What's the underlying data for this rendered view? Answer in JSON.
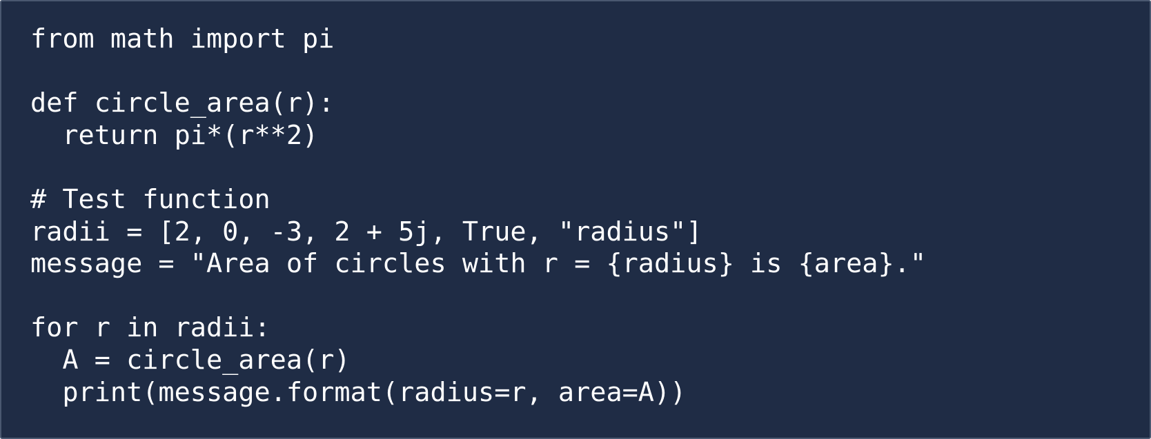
{
  "code": {
    "language": "python",
    "lines": [
      "from math import pi",
      "",
      "def circle_area(r):",
      "  return pi*(r**2)",
      "",
      "# Test function",
      "radii = [2, 0, -3, 2 + 5j, True, \"radius\"]",
      "message = \"Area of circles with r = {radius} is {area}.\"",
      "",
      "for r in radii:",
      "  A = circle_area(r)",
      "  print(message.format(radius=r, area=A))"
    ]
  },
  "colors": {
    "background": "#1f2c45",
    "border": "#4a5870",
    "text": "#ffffff"
  }
}
